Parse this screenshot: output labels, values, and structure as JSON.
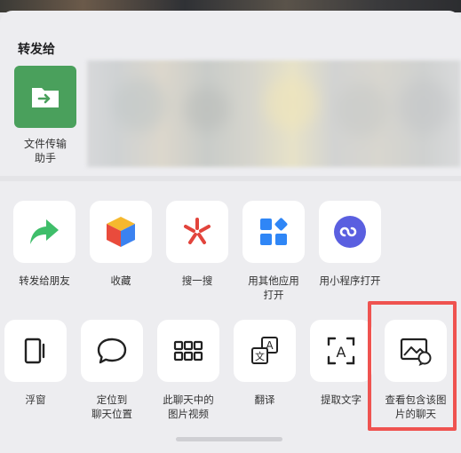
{
  "sheet": {
    "section_title": "转发给"
  },
  "contacts": [
    {
      "name": "文件传输\n助手",
      "icon": "file-transfer-icon",
      "color": "#4aa05c"
    }
  ],
  "actions_row1": [
    {
      "label": "转发给朋友",
      "icon": "forward-arrow-icon",
      "color": "#3fbe6a"
    },
    {
      "label": "收藏",
      "icon": "favorite-cube-icon"
    },
    {
      "label": "搜一搜",
      "icon": "search-one-icon",
      "color": "#e2443c"
    },
    {
      "label": "用其他应用\n打开",
      "icon": "other-app-icon",
      "color": "#2f86f6"
    },
    {
      "label": "用小程序打开",
      "icon": "mini-program-icon",
      "color": "#5a5fe0"
    }
  ],
  "actions_row2": [
    {
      "label": "浮窗",
      "icon": "float-window-icon"
    },
    {
      "label": "定位到\n聊天位置",
      "icon": "chat-bubble-icon"
    },
    {
      "label": "此聊天中的\n图片视频",
      "icon": "grid-icon"
    },
    {
      "label": "翻译",
      "icon": "translate-icon"
    },
    {
      "label": "提取文字",
      "icon": "extract-text-icon"
    },
    {
      "label": "查看包含该图\n片的聊天",
      "icon": "image-chat-icon"
    }
  ],
  "highlight_color": "#ef5350"
}
